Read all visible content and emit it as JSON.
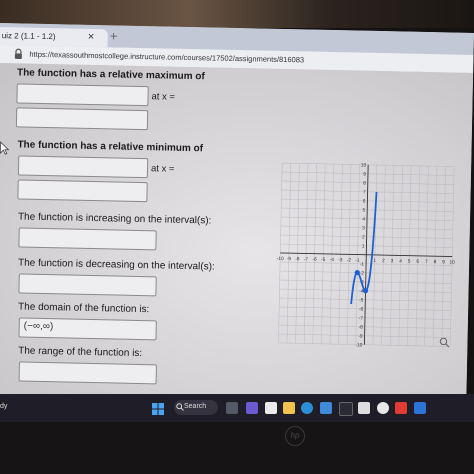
{
  "browser": {
    "tab_title": "uiz 2 (1.1 - 1.2)",
    "tab_close": "×",
    "new_tab": "+",
    "url": "https://texassouthmostcollege.instructure.com/courses/17502/assignments/816083"
  },
  "questions": {
    "rel_max_label": "The function has a relative maximum of",
    "rel_max_at": "at x =",
    "rel_min_label": "The function has a relative minimum of",
    "rel_min_at": "at x =",
    "increasing_label": "The function is increasing on the interval(s):",
    "decreasing_label": "The function is decreasing on the interval(s):",
    "domain_label": "The domain of the function is:",
    "domain_value": "(−∞,∞)",
    "range_label": "The range of the function is:"
  },
  "graph": {
    "x_ticks": [
      "-10",
      "-9",
      "-8",
      "-7",
      "-6",
      "-5",
      "-4",
      "-3",
      "-2",
      "-1",
      "1",
      "2",
      "3",
      "4",
      "5",
      "6",
      "7",
      "8",
      "9",
      "10"
    ],
    "y_ticks": [
      "10",
      "9",
      "8",
      "7",
      "6",
      "5",
      "4",
      "3",
      "2",
      "1",
      "-1",
      "-2",
      "-3",
      "-4",
      "-5",
      "-6",
      "-7",
      "-8",
      "-9",
      "-10"
    ],
    "relative_max_point": [
      -1,
      -2
    ],
    "relative_min_point": [
      0,
      -4
    ],
    "curve_color": "#1f5fd6",
    "zoom_icon": "magnifier-icon"
  },
  "taskbar": {
    "status_text": "dy",
    "search_label": "Search"
  },
  "laptop": {
    "logo_text": "hp"
  }
}
